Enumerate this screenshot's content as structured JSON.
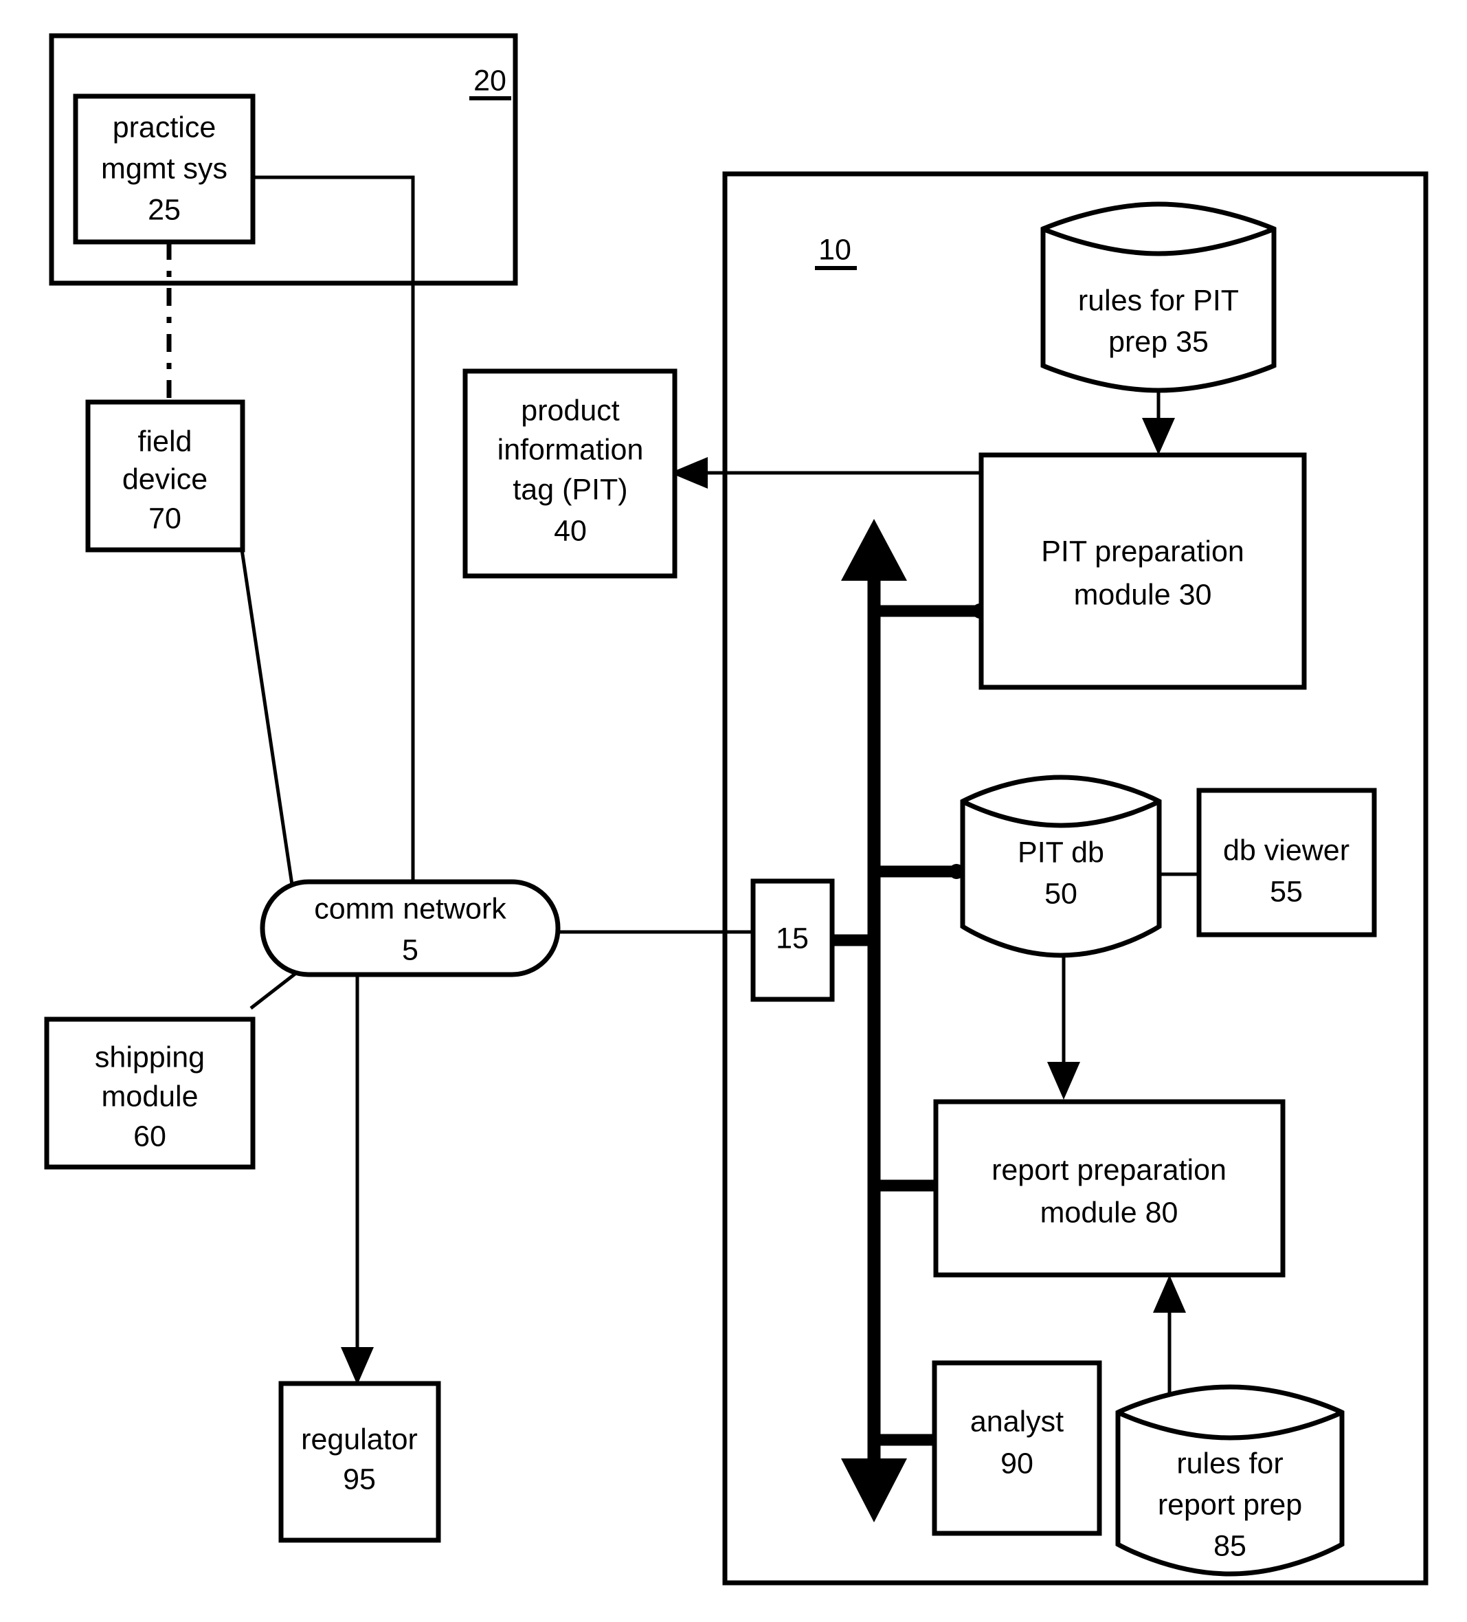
{
  "figure": {
    "type": "patent-block-diagram",
    "background_color": "#ffffff",
    "line_color": "#000000"
  },
  "containers": [
    {
      "id": "container-20",
      "ref": "20",
      "underlined": true,
      "shape": "rectangle"
    },
    {
      "id": "container-10",
      "ref": "10",
      "underlined": true,
      "shape": "rectangle"
    }
  ],
  "nodes": {
    "practice_mgmt_sys": {
      "lines": [
        "practice",
        "mgmt sys",
        "25"
      ],
      "shape": "rectangle",
      "ref": "25"
    },
    "field_device": {
      "lines": [
        "field",
        "device",
        "70"
      ],
      "shape": "rectangle",
      "ref": "70"
    },
    "product_information_tag": {
      "lines": [
        "product",
        "information",
        "tag (PIT)",
        "40"
      ],
      "shape": "rectangle",
      "ref": "40"
    },
    "comm_network": {
      "lines": [
        "comm network",
        "5"
      ],
      "shape": "stadium",
      "ref": "5"
    },
    "shipping_module": {
      "lines": [
        "shipping",
        "module",
        "60"
      ],
      "shape": "rectangle",
      "ref": "60"
    },
    "regulator": {
      "lines": [
        "regulator",
        "95"
      ],
      "shape": "rectangle",
      "ref": "95"
    },
    "interface_15": {
      "lines": [
        "15"
      ],
      "shape": "rectangle",
      "ref": "15"
    },
    "rules_for_pit_prep": {
      "lines": [
        "rules for PIT",
        "prep 35"
      ],
      "shape": "cylinder",
      "ref": "35"
    },
    "pit_preparation_module": {
      "lines": [
        "PIT preparation",
        "module 30"
      ],
      "shape": "rectangle",
      "ref": "30"
    },
    "pit_db": {
      "lines": [
        "PIT db",
        "50"
      ],
      "shape": "cylinder",
      "ref": "50"
    },
    "db_viewer": {
      "lines": [
        "db viewer",
        "55"
      ],
      "shape": "rectangle",
      "ref": "55"
    },
    "report_preparation_module": {
      "lines": [
        "report preparation",
        "module 80"
      ],
      "shape": "rectangle",
      "ref": "80"
    },
    "analyst": {
      "lines": [
        "analyst",
        "90"
      ],
      "shape": "rectangle",
      "ref": "90"
    },
    "rules_for_report_prep": {
      "lines": [
        "rules for",
        "report prep",
        "85"
      ],
      "shape": "cylinder",
      "ref": "85"
    }
  },
  "connections": [
    {
      "from": "practice_mgmt_sys",
      "to": "comm_network",
      "style": "solid"
    },
    {
      "from": "practice_mgmt_sys",
      "to": "field_device",
      "style": "dash-dot"
    },
    {
      "from": "field_device",
      "to": "comm_network",
      "style": "solid"
    },
    {
      "from": "shipping_module",
      "to": "comm_network",
      "style": "solid"
    },
    {
      "from": "comm_network",
      "to": "regulator",
      "style": "solid-arrow"
    },
    {
      "from": "comm_network",
      "to": "interface_15",
      "style": "solid"
    },
    {
      "from": "interface_15",
      "to": "internal_bus",
      "style": "thick-bus"
    },
    {
      "from": "rules_for_pit_prep",
      "to": "pit_preparation_module",
      "style": "solid-arrow"
    },
    {
      "from": "pit_preparation_module",
      "to": "product_information_tag",
      "style": "solid-arrow"
    },
    {
      "from": "pit_preparation_module",
      "to": "internal_bus",
      "style": "thick-bus"
    },
    {
      "from": "pit_db",
      "to": "internal_bus",
      "style": "thick-bus"
    },
    {
      "from": "pit_db",
      "to": "db_viewer",
      "style": "solid"
    },
    {
      "from": "pit_db",
      "to": "report_preparation_module",
      "style": "solid-arrow"
    },
    {
      "from": "report_preparation_module",
      "to": "internal_bus",
      "style": "thick-bus"
    },
    {
      "from": "rules_for_report_prep",
      "to": "report_preparation_module",
      "style": "solid-arrow"
    },
    {
      "from": "analyst",
      "to": "internal_bus",
      "style": "thick-bus"
    }
  ]
}
